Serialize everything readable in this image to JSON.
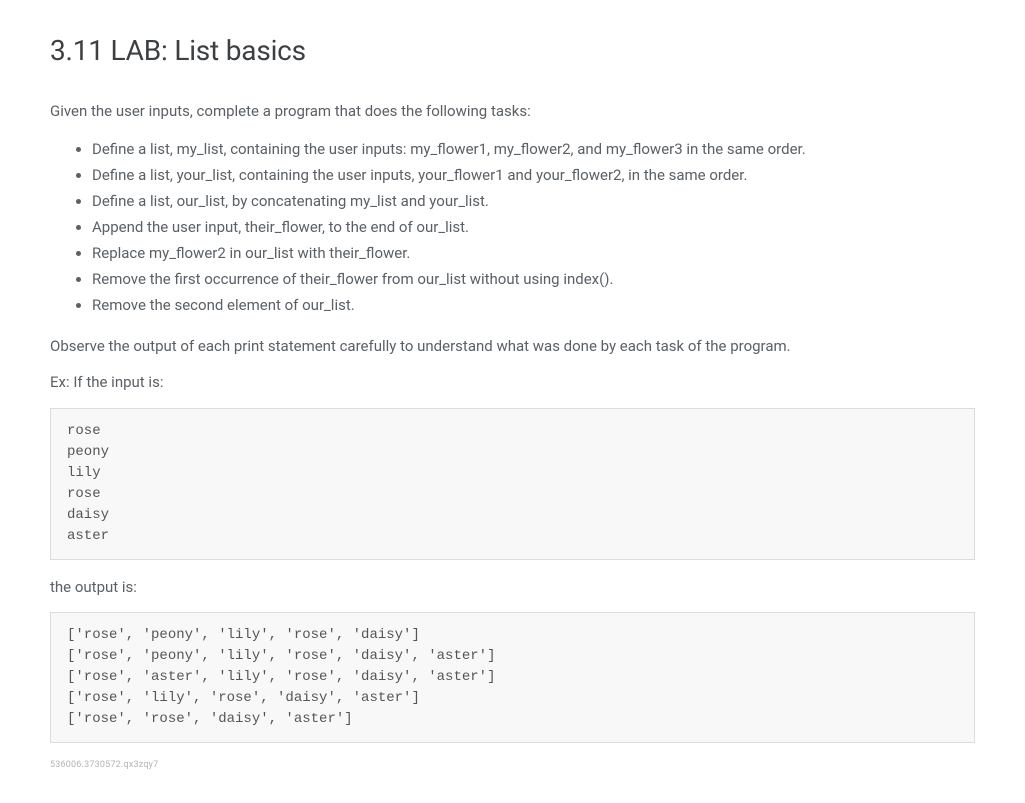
{
  "title": "3.11 LAB: List basics",
  "intro": "Given the user inputs, complete a program that does the following tasks:",
  "tasks": [
    "Define a list, my_list, containing the user inputs: my_flower1, my_flower2, and my_flower3 in the same order.",
    "Define a list, your_list, containing the user inputs, your_flower1 and your_flower2, in the same order.",
    "Define a list, our_list, by concatenating my_list and your_list.",
    "Append the user input, their_flower, to the end of our_list.",
    "Replace my_flower2 in our_list with their_flower.",
    "Remove the first occurrence of their_flower from our_list without using index().",
    "Remove the second element of our_list."
  ],
  "observe": "Observe the output of each print statement carefully to understand what was done by each task of the program.",
  "example_label": "Ex: If the input is:",
  "example_input": "rose\npeony\nlily\nrose\ndaisy\naster",
  "output_label": "the output is:",
  "example_output": "['rose', 'peony', 'lily', 'rose', 'daisy']\n['rose', 'peony', 'lily', 'rose', 'daisy', 'aster']\n['rose', 'aster', 'lily', 'rose', 'daisy', 'aster']\n['rose', 'lily', 'rose', 'daisy', 'aster']\n['rose', 'rose', 'daisy', 'aster']",
  "footer_id": "536006.3730572.qx3zqy7"
}
